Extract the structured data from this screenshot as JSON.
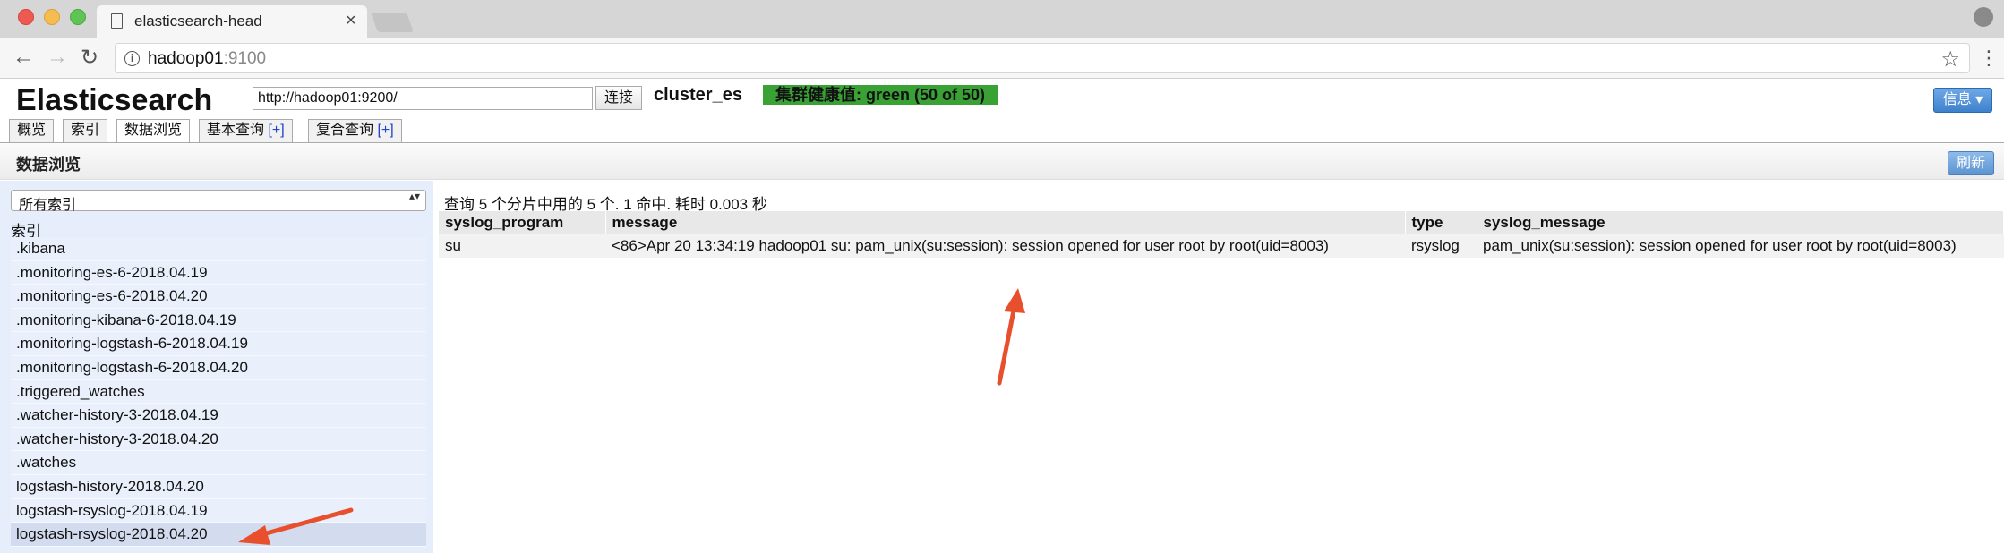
{
  "browser": {
    "tab_title": "elasticsearch-head",
    "tab_close": "×",
    "url_host": "hadoop01",
    "url_port": ":9100",
    "info_icon": "i",
    "star": "☆",
    "kebab": "⋮",
    "back": "←",
    "forward": "→",
    "reload": "↻",
    "icons": [
      "page-icon",
      "close-icon",
      "back-icon",
      "forward-icon",
      "reload-icon",
      "info-icon",
      "star-icon",
      "menu-icon",
      "profile-icon"
    ]
  },
  "header": {
    "logo": "Elasticsearch",
    "connect_url": "http://hadoop01:9200/",
    "connect_button": "连接",
    "cluster_name": "cluster_es",
    "health": "集群健康值: green (50 of 50)",
    "health_color": "#3aa234",
    "info_button": "信息 ▾"
  },
  "tabs": [
    {
      "label": "概览",
      "plus": ""
    },
    {
      "label": "索引",
      "plus": ""
    },
    {
      "label": "数据浏览",
      "plus": ""
    },
    {
      "label": "基本查询 ",
      "plus": "[+]"
    },
    {
      "label": "复合查询 ",
      "plus": "[+]"
    }
  ],
  "active_tab": "数据浏览",
  "section": {
    "title": "数据浏览",
    "refresh_button": "刷新"
  },
  "sidebar": {
    "select_value": "所有索引",
    "select_arrows": "▴▾",
    "heading": "索引",
    "items": [
      ".kibana",
      ".monitoring-es-6-2018.04.19",
      ".monitoring-es-6-2018.04.20",
      ".monitoring-kibana-6-2018.04.19",
      ".monitoring-logstash-6-2018.04.19",
      ".monitoring-logstash-6-2018.04.20",
      ".triggered_watches",
      ".watcher-history-3-2018.04.19",
      ".watcher-history-3-2018.04.20",
      ".watches",
      "logstash-history-2018.04.20",
      "logstash-rsyslog-2018.04.19",
      "logstash-rsyslog-2018.04.20"
    ],
    "selected_item": "logstash-rsyslog-2018.04.20"
  },
  "results": {
    "summary": "查询 5 个分片中用的 5 个. 1 命中. 耗时 0.003 秒",
    "columns": [
      "syslog_program",
      "message",
      "type",
      "syslog_message"
    ],
    "rows": [
      [
        "su",
        "<86>Apr 20 13:34:19 hadoop01 su: pam_unix(su:session): session opened for user root by root(uid=8003)",
        "rsyslog",
        "pam_unix(su:session): session opened for user root by root(uid=8003)"
      ]
    ]
  },
  "annotation_color": "#e8502d"
}
